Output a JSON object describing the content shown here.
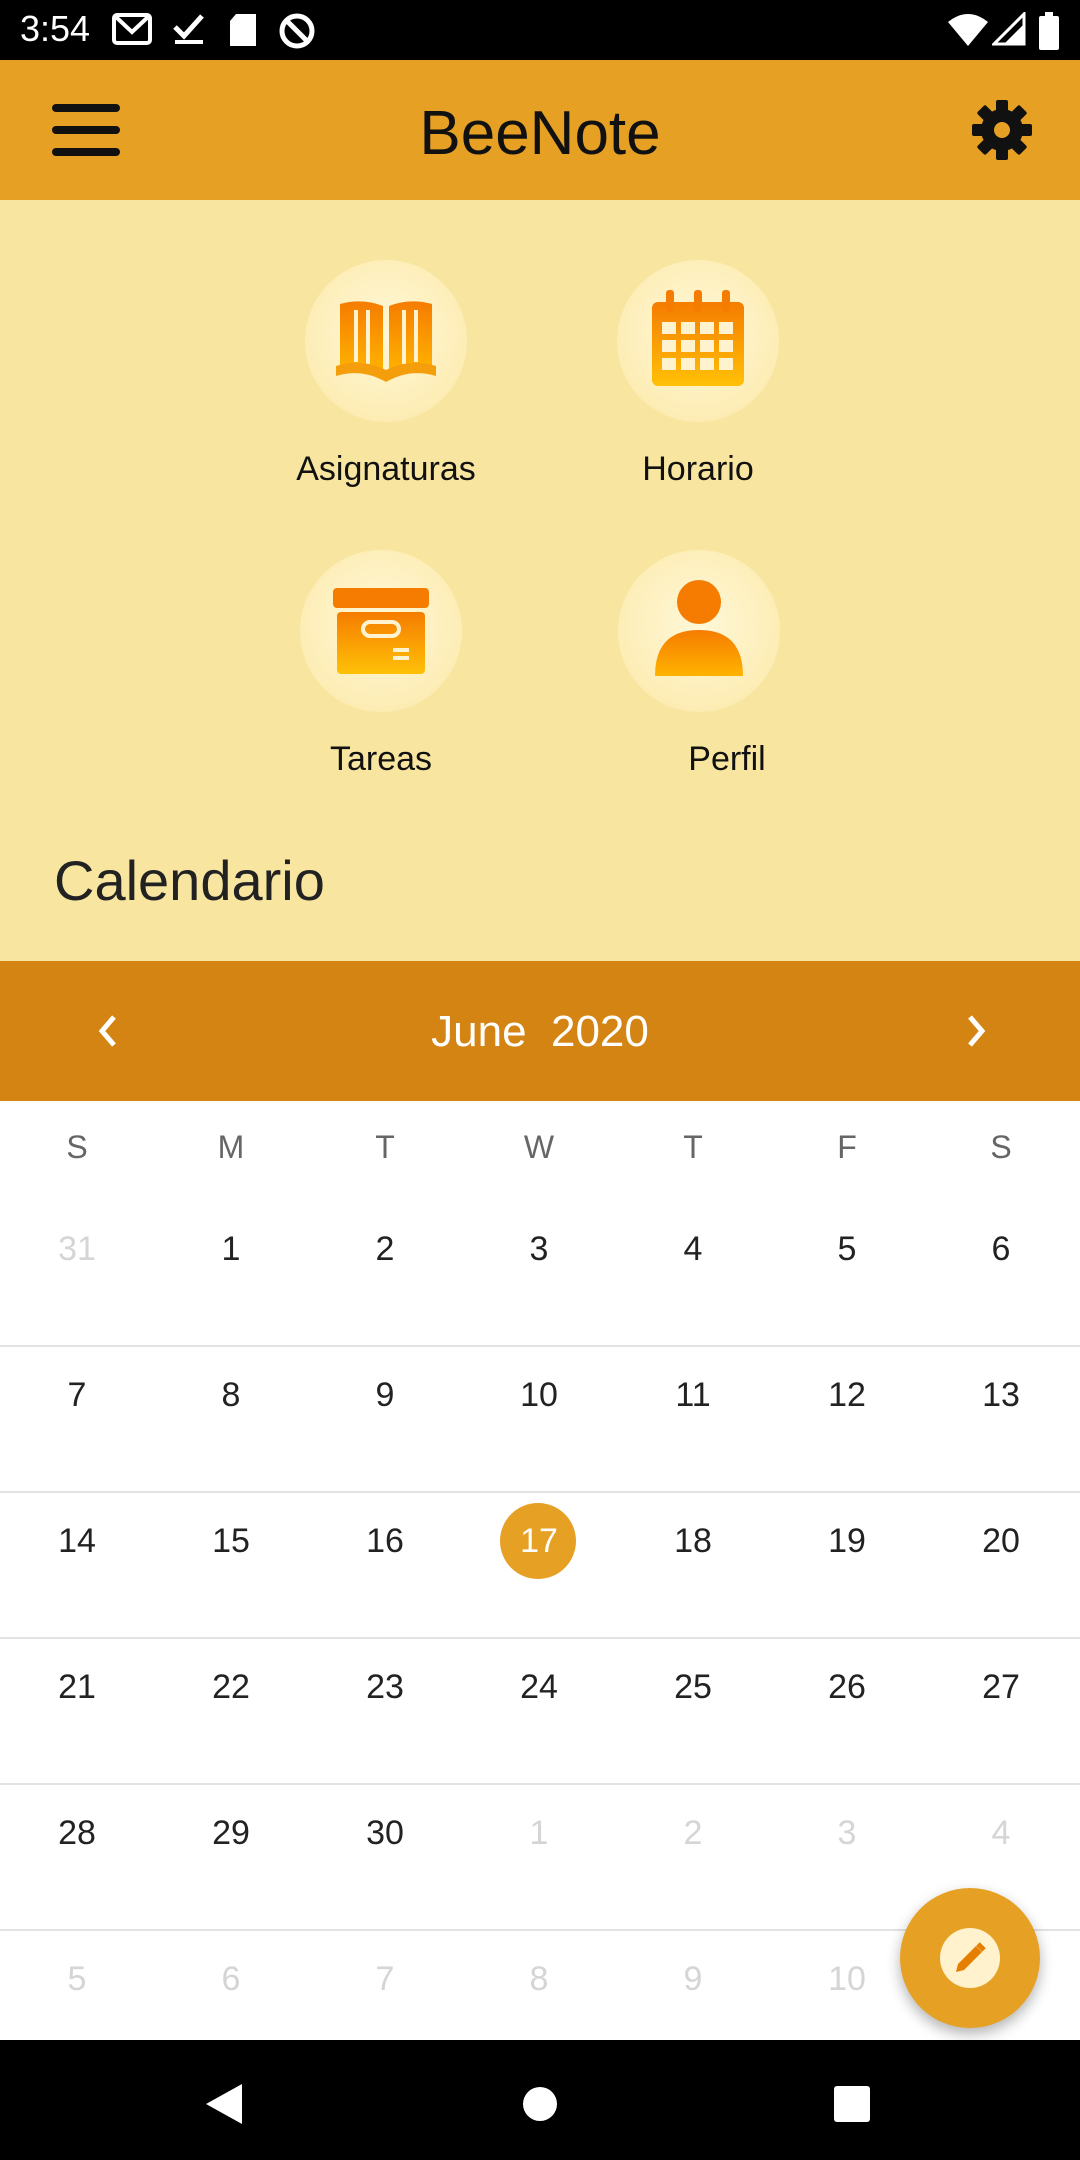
{
  "status_bar": {
    "time": "3:54",
    "icons": [
      "gmail-icon",
      "check-icon",
      "sd-card-icon",
      "data-saver-icon",
      "wifi-icon",
      "signal-icon",
      "battery-icon"
    ]
  },
  "app_bar": {
    "title": "BeeNote",
    "menu_icon": "hamburger-menu-icon",
    "settings_icon": "gear-icon"
  },
  "shortcuts": [
    {
      "label": "Asignaturas",
      "icon": "book-icon"
    },
    {
      "label": "Horario",
      "icon": "calendar-icon"
    },
    {
      "label": "Tareas",
      "icon": "archive-box-icon"
    },
    {
      "label": "Perfil",
      "icon": "person-icon"
    }
  ],
  "calendar": {
    "heading": "Calendario",
    "month_label": "June  2020",
    "weekdays": [
      "S",
      "M",
      "T",
      "W",
      "T",
      "F",
      "S"
    ],
    "weeks": [
      [
        "31",
        "1",
        "2",
        "3",
        "4",
        "5",
        "6"
      ],
      [
        "7",
        "8",
        "9",
        "10",
        "11",
        "12",
        "13"
      ],
      [
        "14",
        "15",
        "16",
        "17",
        "18",
        "19",
        "20"
      ],
      [
        "21",
        "22",
        "23",
        "24",
        "25",
        "26",
        "27"
      ],
      [
        "28",
        "29",
        "30",
        "1",
        "2",
        "3",
        "4"
      ],
      [
        "5",
        "6",
        "7",
        "8",
        "9",
        "10",
        ""
      ]
    ],
    "selected_day": "17"
  },
  "fab": {
    "icon": "pencil-edit-icon"
  },
  "colors": {
    "accent": "#E6A024",
    "month_bar": "#D48412",
    "background": "#F8E6A0"
  },
  "nav_bar": [
    "back-icon",
    "home-icon",
    "recents-icon"
  ]
}
